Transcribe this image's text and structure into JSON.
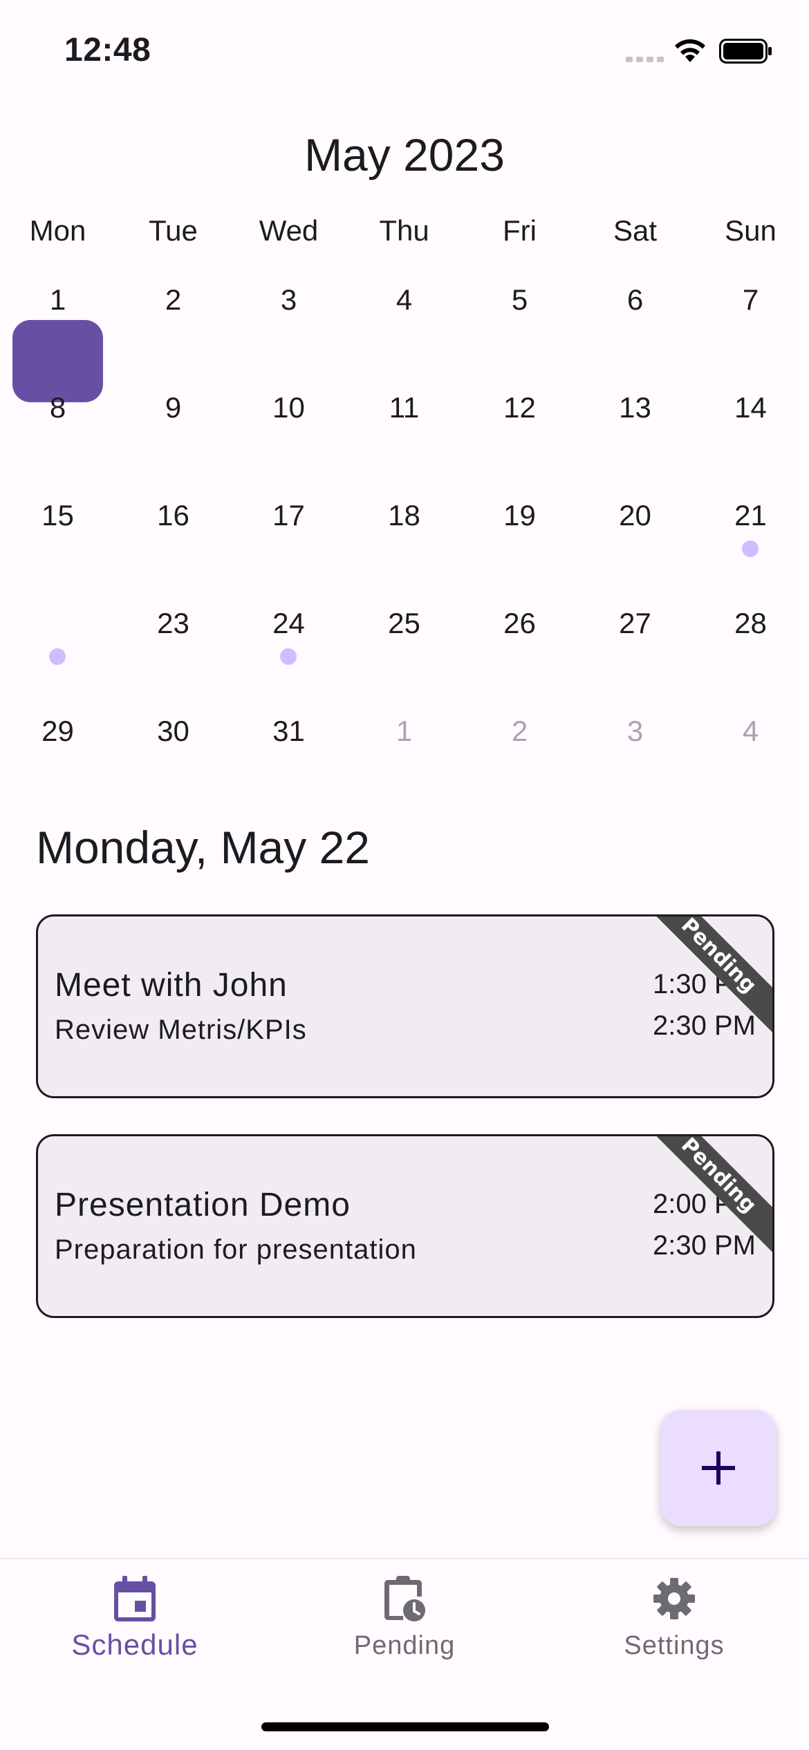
{
  "status_bar": {
    "time": "12:48"
  },
  "calendar": {
    "month_title": "May 2023",
    "weekdays": [
      "Mon",
      "Tue",
      "Wed",
      "Thu",
      "Fri",
      "Sat",
      "Sun"
    ],
    "days": [
      "1",
      "2",
      "3",
      "4",
      "5",
      "6",
      "7",
      "8",
      "9",
      "10",
      "11",
      "12",
      "13",
      "14",
      "15",
      "16",
      "17",
      "18",
      "19",
      "20",
      "21",
      "22",
      "23",
      "24",
      "25",
      "26",
      "27",
      "28",
      "29",
      "30",
      "31",
      "1",
      "2",
      "3",
      "4"
    ],
    "selected_day": "22"
  },
  "day_header": "Monday, May 22",
  "events": [
    {
      "title": "Meet with John",
      "description": "Review Metris/KPIs",
      "start": "1:30 PM",
      "end": "2:30 PM",
      "status": "Pending"
    },
    {
      "title": "Presentation Demo",
      "description": "Preparation for presentation",
      "start": "2:00 PM",
      "end": "2:30 PM",
      "status": "Pending"
    }
  ],
  "fab": {
    "icon": "plus-icon"
  },
  "nav": {
    "items": [
      {
        "label": "Schedule",
        "icon": "calendar-icon",
        "active": true
      },
      {
        "label": "Pending",
        "icon": "clipboard-clock-icon",
        "active": false
      },
      {
        "label": "Settings",
        "icon": "gear-icon",
        "active": false
      }
    ]
  },
  "colors": {
    "primary": "#6750a4",
    "event_dot": "#d0bcff",
    "card_bg": "#f0ecf2",
    "fab_bg": "#eaddff",
    "ribbon": "#4a4a4a"
  }
}
